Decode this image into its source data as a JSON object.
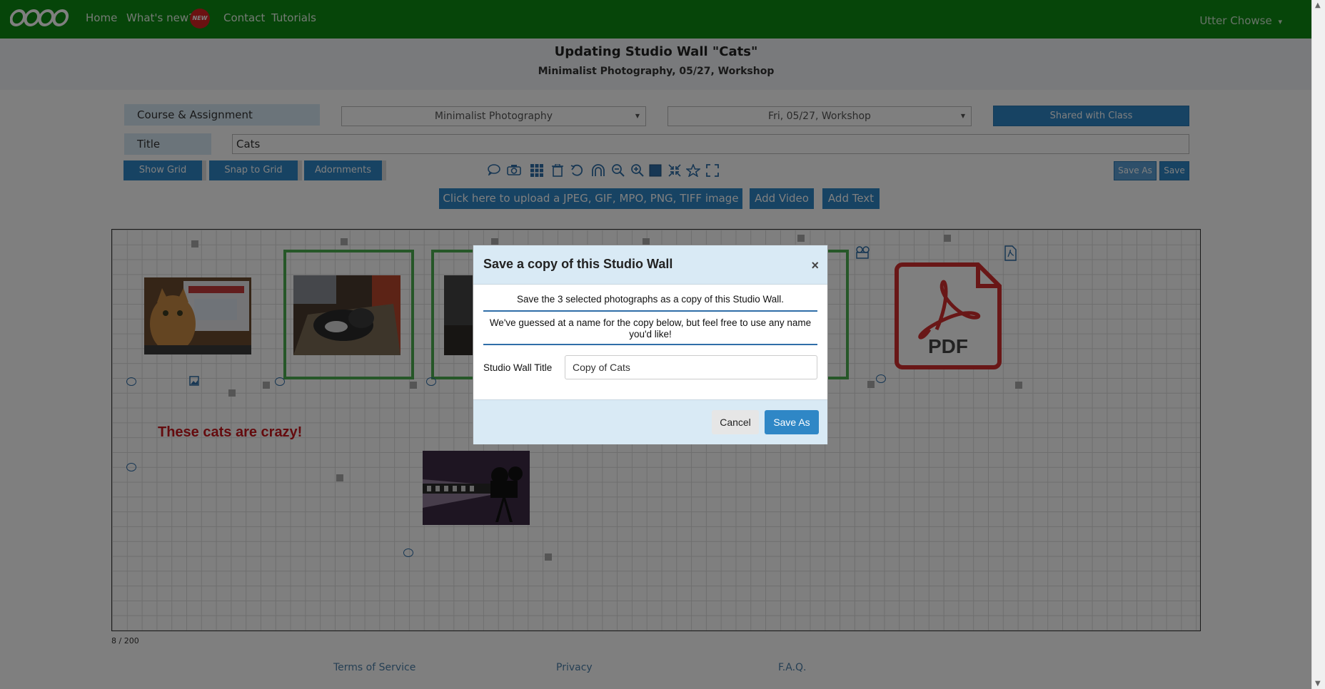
{
  "nav": {
    "home": "Home",
    "whats_new": "What's new?",
    "new_badge": "NEW",
    "contact": "Contact",
    "tutorials": "Tutorials",
    "user": "Utter Chowse",
    "user_caret": "▾"
  },
  "header": {
    "title": "Updating Studio Wall \"Cats\"",
    "subtitle": "Minimalist Photography, 05/27, Workshop"
  },
  "form": {
    "course_assignment_label": "Course & Assignment",
    "course_select": "Minimalist Photography",
    "assignment_select": "Fri, 05/27, Workshop",
    "shared_button": "Shared with Class",
    "title_label": "Title",
    "title_value": "Cats"
  },
  "toolbar": {
    "show_grid": "Show Grid",
    "snap_to_grid": "Snap to Grid",
    "adornments": "Adornments",
    "save_as": "Save As",
    "save": "Save",
    "icons": [
      "comment-icon",
      "camera-icon",
      "grid-icon",
      "trash-icon",
      "undo-icon",
      "magnet-icon",
      "zoom-out-icon",
      "zoom-in-icon",
      "fill-icon",
      "shrink-icon",
      "star-icon",
      "expand-icon"
    ]
  },
  "uploads": {
    "upload_image": "Click here to upload a JPEG, GIF, MPO, PNG, TIFF image or PDF",
    "add_video": "Add Video",
    "add_text": "Add Text"
  },
  "canvas": {
    "text_item": "These cats are crazy!",
    "pdf_label": "PDF",
    "counter": "8 / 200"
  },
  "footer": {
    "terms": "Terms of Service",
    "privacy": "Privacy",
    "faq": "F.A.Q."
  },
  "modal": {
    "title": "Save a copy of this Studio Wall",
    "close": "×",
    "line1": "Save the 3 selected photographs as a copy of this Studio Wall.",
    "line2": "We've guessed at a name for the copy below, but feel free to use any name you'd like!",
    "field_label": "Studio Wall Title",
    "field_value": "Copy of Cats",
    "cancel": "Cancel",
    "save_as": "Save As"
  },
  "colors": {
    "navbar": "#0d8a12",
    "primary": "#2f87c6",
    "frame_green": "#4caf50",
    "pdf_red": "#d32f2f",
    "text_red": "#c8161d"
  }
}
